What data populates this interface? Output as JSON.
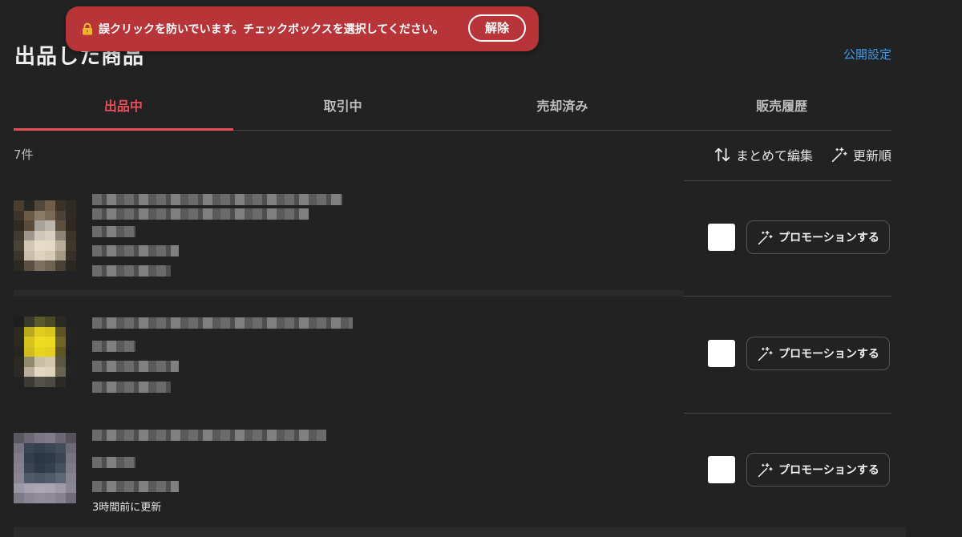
{
  "header": {
    "title": "出品した商品",
    "publish_settings": "公開設定"
  },
  "tabs": [
    {
      "label": "出品中",
      "active": true
    },
    {
      "label": "取引中",
      "active": false
    },
    {
      "label": "売却済み",
      "active": false
    },
    {
      "label": "販売履歴",
      "active": false
    }
  ],
  "list": {
    "count": "7件",
    "bulk_edit": "まとめて編集",
    "sort": "更新順"
  },
  "items": [
    {
      "promote_label": "プロモーションする",
      "checked": false
    },
    {
      "promote_label": "プロモーションする",
      "checked": false
    },
    {
      "promote_label": "プロモーションする",
      "checked": false,
      "updated": "3時間前に更新"
    }
  ],
  "toast": {
    "message": "誤クリックを防いでいます。チェックボックスを選択してください。",
    "release_label": "解除",
    "color": "#b73538"
  },
  "colors": {
    "accent": "#ea4f59",
    "link": "#3d9be9",
    "background": "#222222"
  },
  "icons": [
    "lock-icon",
    "sort-arrows-icon",
    "sparkle-wand-icon"
  ]
}
